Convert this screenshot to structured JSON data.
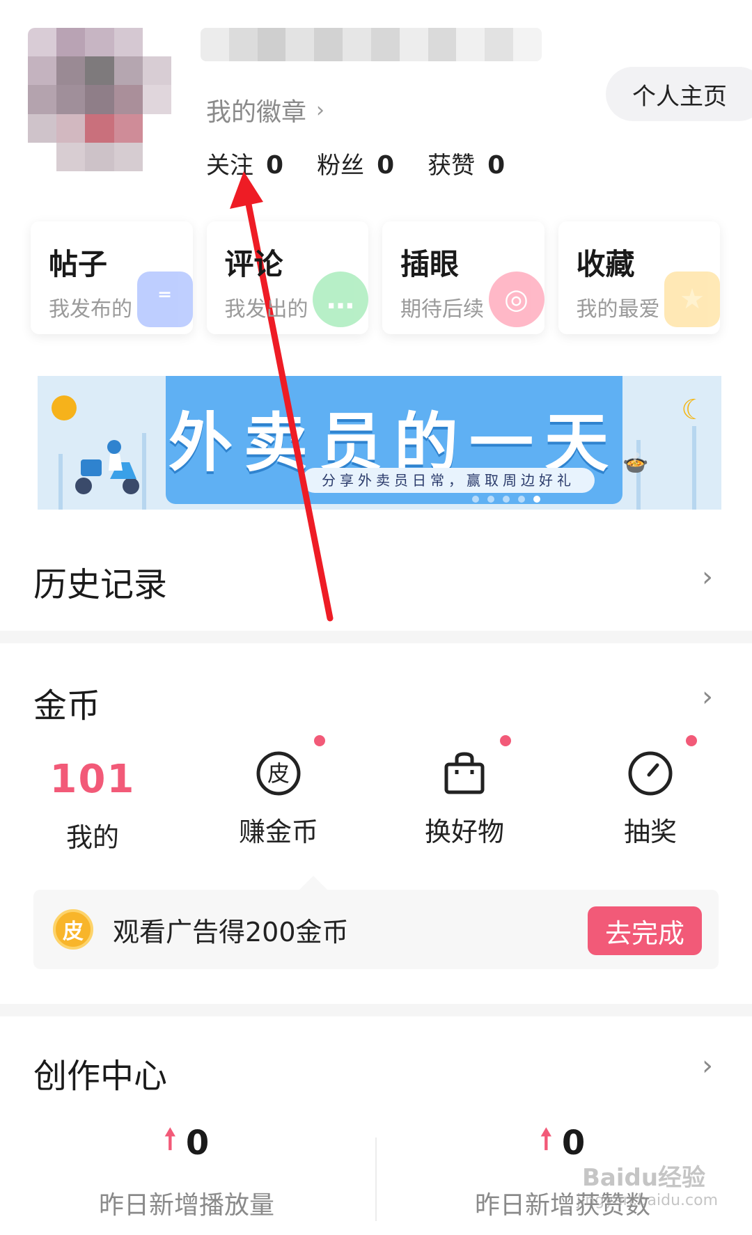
{
  "profile": {
    "badge_link": "我的徽章",
    "home_button": "个人主页",
    "stats": [
      {
        "label": "关注",
        "value": "0"
      },
      {
        "label": "粉丝",
        "value": "0"
      },
      {
        "label": "获赞",
        "value": "0"
      }
    ]
  },
  "quick_cards": [
    {
      "title": "帖子",
      "subtitle": "我发布的",
      "icon": "post-icon",
      "color": "#8aa7ff"
    },
    {
      "title": "评论",
      "subtitle": "我发出的",
      "icon": "comment-icon",
      "color": "#7ee29a"
    },
    {
      "title": "插眼",
      "subtitle": "期待后续",
      "icon": "eye-icon",
      "color": "#ff7f9b"
    },
    {
      "title": "收藏",
      "subtitle": "我的最爱",
      "icon": "star-icon",
      "color": "#ffd77a"
    }
  ],
  "banner": {
    "title": "外卖员的一天",
    "subtitle": "分享外卖员日常，赢取周边好礼",
    "page_count": 5,
    "active_page": 5
  },
  "history": {
    "title": "历史记录"
  },
  "coins": {
    "title": "金币",
    "balance": "101",
    "items": [
      {
        "label": "我的",
        "icon": "coin-balance"
      },
      {
        "label": "赚金币",
        "icon": "pi-coin-icon"
      },
      {
        "label": "换好物",
        "icon": "shopping-bag-icon"
      },
      {
        "label": "抽奖",
        "icon": "lottery-dial-icon"
      }
    ],
    "task": {
      "badge": "皮",
      "text": "观看广告得200金币",
      "button": "去完成"
    }
  },
  "creation": {
    "title": "创作中心",
    "stats": [
      {
        "label": "昨日新增播放量",
        "value": "0"
      },
      {
        "label": "昨日新增获赞数",
        "value": "0"
      }
    ]
  },
  "watermark": {
    "brand": "Baidu经验",
    "url": "jingyan.baidu.com"
  },
  "colors": {
    "accent": "#f25a78",
    "annotation_arrow": "#ee1c25"
  }
}
